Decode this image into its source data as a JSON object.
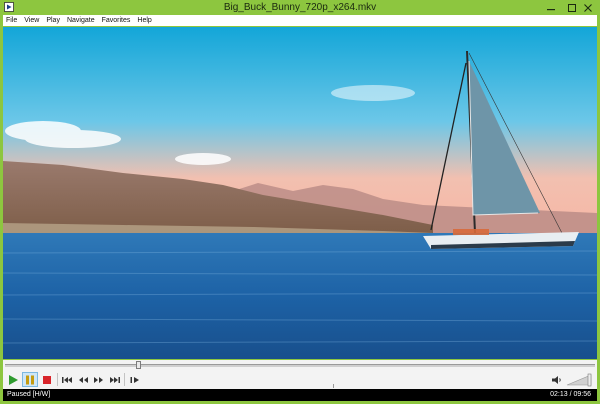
{
  "window": {
    "title": "Big_Buck_Bunny_720p_x264.mkv",
    "accent_color": "#8dc63f"
  },
  "menu": {
    "items": [
      "File",
      "View",
      "Play",
      "Navigate",
      "Favorites",
      "Help"
    ]
  },
  "seek": {
    "position_fraction": 0.226
  },
  "controls": {
    "icons": [
      "play-icon",
      "pause-icon",
      "stop-icon",
      "skip-back-icon",
      "rewind-icon",
      "fast-forward-icon",
      "skip-forward-icon",
      "frame-step-icon",
      "speaker-icon",
      "volume-slider"
    ]
  },
  "status": {
    "state": "Paused [H/W]",
    "time": "02:13 / 09:56"
  }
}
